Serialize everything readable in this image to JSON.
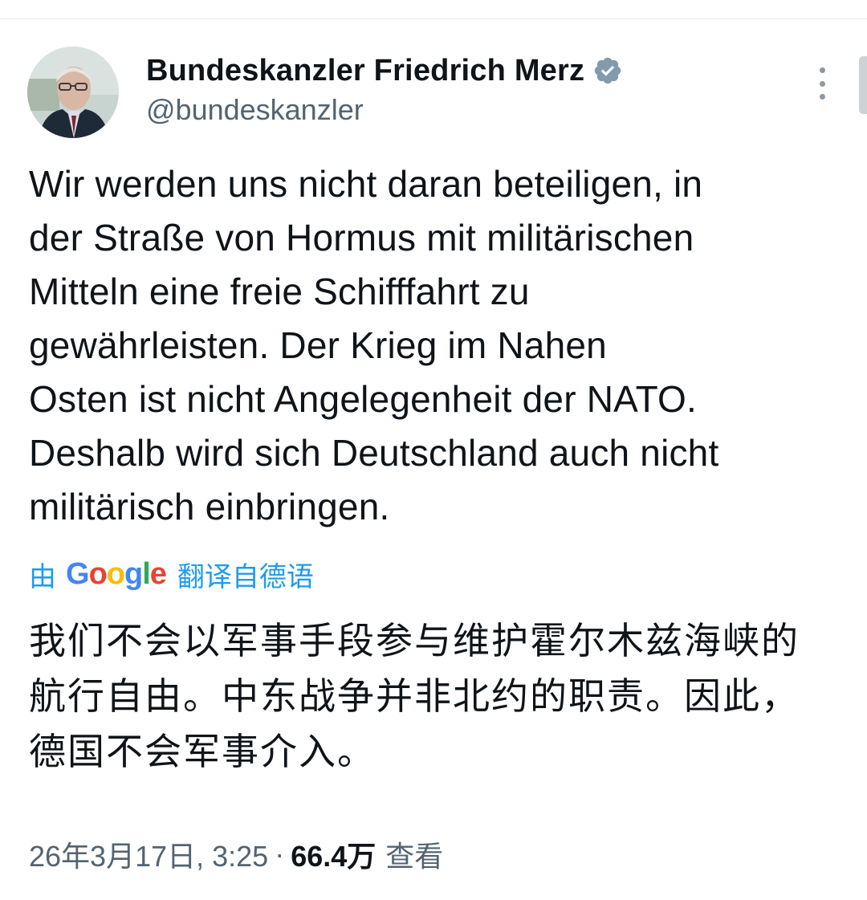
{
  "tweet": {
    "author": {
      "display_name": "Bundeskanzler Friedrich Merz",
      "handle": "@bundeskanzler",
      "verified_icon": "verified-badge-icon",
      "verified_color": "#829aab"
    },
    "text": "Wir werden uns nicht daran beteiligen, in\nder Straße von Hormus mit militärischen\nMitteln eine freie Schifffahrt zu\ngewährleisten. Der Krieg im Nahen\nOsten ist nicht Angelegenheit der NATO.\nDeshalb wird sich Deutschland auch nicht\nmilitärisch einbringen.",
    "translation": {
      "prefix": "由",
      "provider": "Google",
      "suffix": "翻译自德语",
      "text": "我们不会以军事手段参与维护霍尔木兹海峡的航行自由。中东战争并非北约的职责。因此，德国不会军事介入。",
      "link_color": "#1d9bf0"
    },
    "meta": {
      "timestamp": "26年3月17日, 3:25",
      "separator": "·",
      "views_count": "66.4万",
      "views_label": "查看"
    }
  },
  "icons": {
    "more": "more-vertical-icon",
    "avatar": "avatar-portrait"
  }
}
